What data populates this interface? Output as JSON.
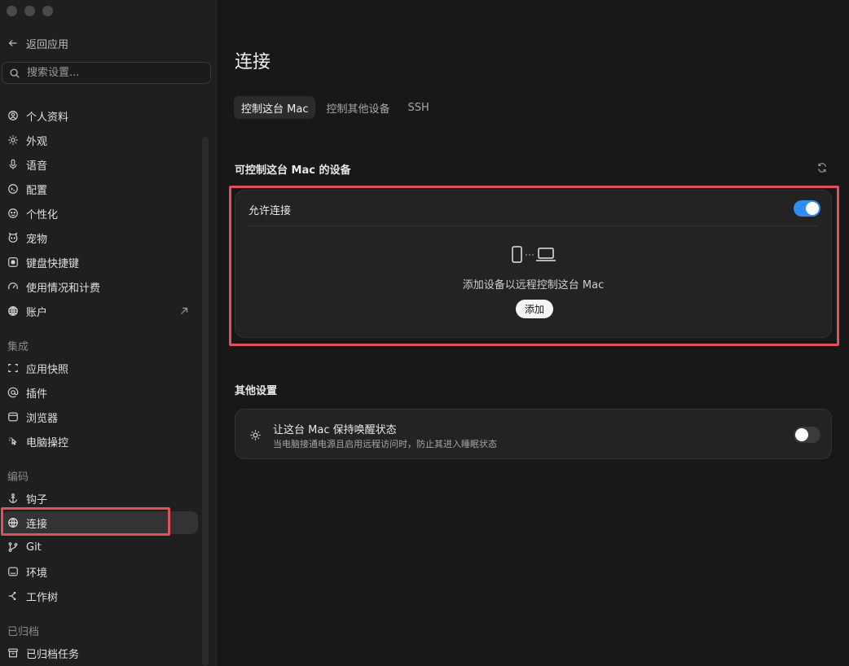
{
  "sidebar": {
    "back_label": "返回应用",
    "search_placeholder": "搜索设置...",
    "items": [
      {
        "label": "个人资料",
        "icon": "profile-icon"
      },
      {
        "label": "外观",
        "icon": "appearance-icon"
      },
      {
        "label": "语音",
        "icon": "microphone-icon"
      },
      {
        "label": "配置",
        "icon": "config-icon"
      },
      {
        "label": "个性化",
        "icon": "personalize-icon"
      },
      {
        "label": "宠物",
        "icon": "pet-icon"
      },
      {
        "label": "键盘快捷键",
        "icon": "keyboard-icon"
      },
      {
        "label": "使用情况和计费",
        "icon": "gauge-icon"
      },
      {
        "label": "账户",
        "icon": "account-icon"
      }
    ],
    "section_integrations": "集成",
    "integrations": [
      {
        "label": "应用快照",
        "icon": "snapshot-icon"
      },
      {
        "label": "插件",
        "icon": "at-icon"
      },
      {
        "label": "浏览器",
        "icon": "browser-icon"
      },
      {
        "label": "电脑操控",
        "icon": "computer-control-icon"
      }
    ],
    "section_coding": "编码",
    "coding": [
      {
        "label": "钩子",
        "icon": "anchor-icon"
      },
      {
        "label": "连接",
        "icon": "globe-icon"
      },
      {
        "label": "Git",
        "icon": "git-branch-icon"
      },
      {
        "label": "环境",
        "icon": "environment-icon"
      },
      {
        "label": "工作树",
        "icon": "worktree-icon"
      }
    ],
    "section_archived": "已归档",
    "archived": [
      {
        "label": "已归档任务",
        "icon": "archive-icon"
      }
    ]
  },
  "main": {
    "title": "连接",
    "tabs": [
      "控制这台 Mac",
      "控制其他设备",
      "SSH"
    ],
    "devices_section_title": "可控制这台 Mac 的设备",
    "allow_label": "允许连接",
    "allow_on": true,
    "empty_text": "添加设备以远程控制这台 Mac",
    "add_label": "添加",
    "other_section_title": "其他设置",
    "keep_awake_title": "让这台 Mac 保持唤醒状态",
    "keep_awake_desc": "当电脑接通电源且启用远程访问时，防止其进入睡眠状态",
    "keep_awake_on": false
  },
  "colors": {
    "accent": "#2f8cf0",
    "highlight": "#e0525a"
  }
}
